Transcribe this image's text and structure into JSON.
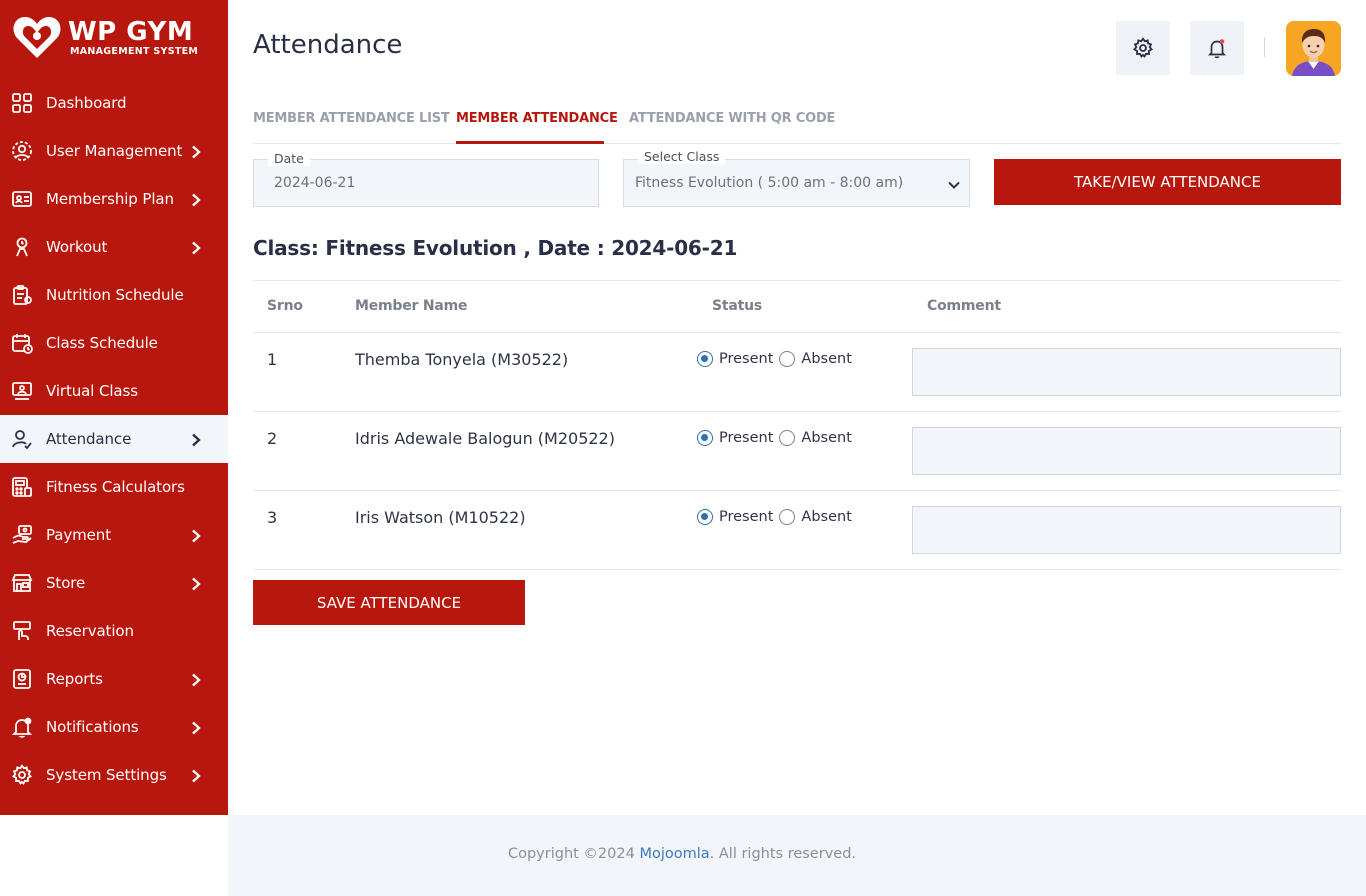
{
  "brand": {
    "title": "WP GYM",
    "subtitle": "MANAGEMENT SYSTEM"
  },
  "sidebar": {
    "items": [
      {
        "label": "Dashboard",
        "icon": "dashboard-icon",
        "has_submenu": false,
        "active": false
      },
      {
        "label": "User Management",
        "icon": "user-gear-icon",
        "has_submenu": true,
        "active": false
      },
      {
        "label": "Membership Plan",
        "icon": "membership-card-icon",
        "has_submenu": true,
        "active": false
      },
      {
        "label": "Workout",
        "icon": "workout-icon",
        "has_submenu": true,
        "active": false
      },
      {
        "label": "Nutrition Schedule",
        "icon": "nutrition-icon",
        "has_submenu": false,
        "active": false
      },
      {
        "label": "Class Schedule",
        "icon": "calendar-icon",
        "has_submenu": false,
        "active": false
      },
      {
        "label": "Virtual Class",
        "icon": "virtual-class-icon",
        "has_submenu": false,
        "active": false
      },
      {
        "label": "Attendance",
        "icon": "attendance-icon",
        "has_submenu": true,
        "active": true
      },
      {
        "label": "Fitness Calculators",
        "icon": "calculator-icon",
        "has_submenu": false,
        "active": false
      },
      {
        "label": "Payment",
        "icon": "payment-icon",
        "has_submenu": true,
        "active": false
      },
      {
        "label": "Store",
        "icon": "store-icon",
        "has_submenu": true,
        "active": false
      },
      {
        "label": "Reservation",
        "icon": "reservation-icon",
        "has_submenu": false,
        "active": false
      },
      {
        "label": "Reports",
        "icon": "reports-icon",
        "has_submenu": true,
        "active": false
      },
      {
        "label": "Notifications",
        "icon": "bell-icon",
        "has_submenu": true,
        "active": false
      },
      {
        "label": "System Settings",
        "icon": "gear-icon",
        "has_submenu": true,
        "active": false
      }
    ]
  },
  "header": {
    "title": "Attendance",
    "settings_icon": "gear-icon",
    "notification_icon": "bell-icon"
  },
  "tabs": [
    {
      "label": "MEMBER ATTENDANCE LIST",
      "active": false
    },
    {
      "label": "MEMBER ATTENDANCE",
      "active": true
    },
    {
      "label": "ATTENDANCE WITH QR CODE",
      "active": false
    }
  ],
  "form": {
    "date_label": "Date",
    "date_value": "2024-06-21",
    "class_label": "Select Class",
    "class_value": "Fitness Evolution ( 5:00 am - 8:00 am)",
    "submit_label": "TAKE/VIEW ATTENDANCE"
  },
  "class_heading": "Class: Fitness Evolution , Date : 2024-06-21",
  "table": {
    "columns": [
      "Srno",
      "Member Name",
      "Status",
      "Comment"
    ],
    "rows": [
      {
        "srno": "1",
        "name": "Themba Tonyela (M30522)",
        "status": "Present",
        "comment": ""
      },
      {
        "srno": "2",
        "name": "Idris Adewale Balogun (M20522)",
        "status": "Present",
        "comment": ""
      },
      {
        "srno": "3",
        "name": "Iris Watson (M10522)",
        "status": "Present",
        "comment": ""
      }
    ],
    "present_label": "Present",
    "absent_label": "Absent"
  },
  "save_label": "SAVE ATTENDANCE",
  "footer": {
    "prefix": "Copyright ©2024 ",
    "link": "Mojoomla",
    "suffix": ". All rights reserved."
  },
  "colors": {
    "brand": "#b8170d",
    "active_bg": "#f2f5f9",
    "radio": "#2f6fb5",
    "link": "#3b7bbf"
  }
}
